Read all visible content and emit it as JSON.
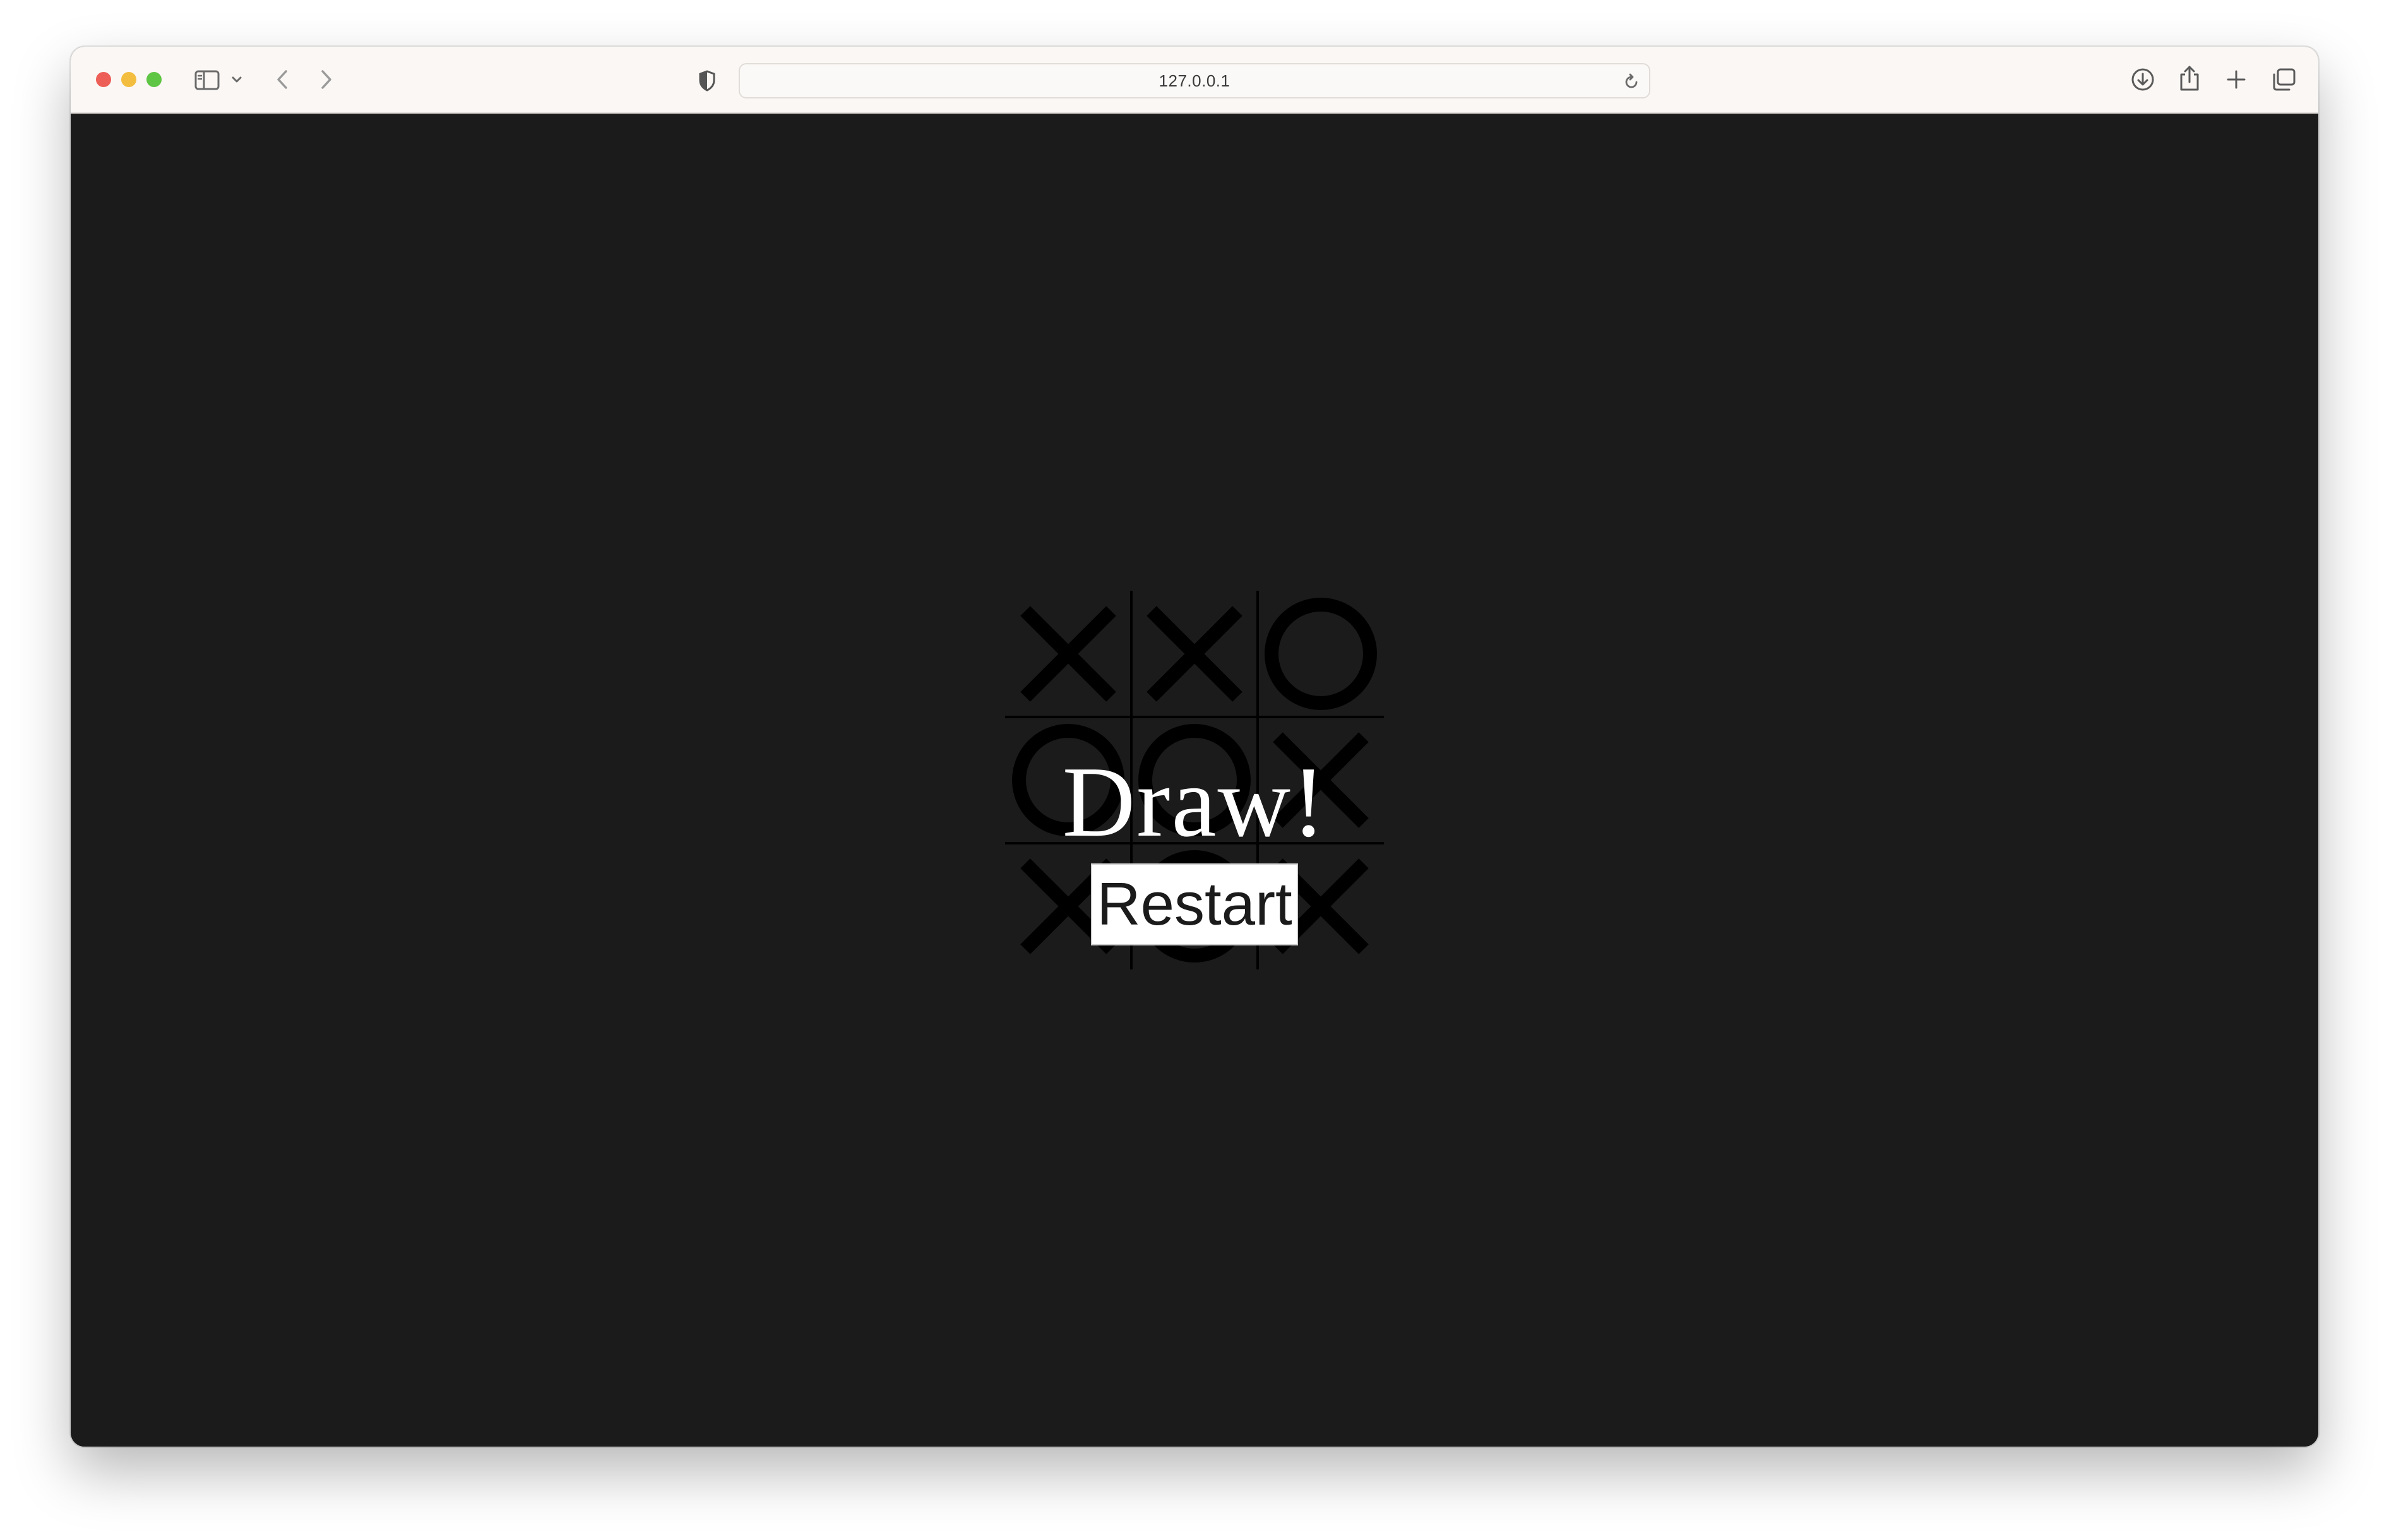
{
  "browser": {
    "address": "127.0.0.1",
    "icons": {
      "sidebar": "sidebar-icon",
      "chevron": "chevron-down-icon",
      "back": "back-arrow-icon",
      "forward": "forward-arrow-icon",
      "shield": "privacy-shield-icon",
      "reload": "reload-icon",
      "download": "download-icon",
      "share": "share-icon",
      "new_tab": "plus-icon",
      "tabs": "tabs-overview-icon"
    }
  },
  "game": {
    "result_text": "Draw!",
    "restart_label": "Restart",
    "board": [
      [
        "X",
        "X",
        "O"
      ],
      [
        "O",
        "O",
        "X"
      ],
      [
        "X",
        "O",
        "X"
      ]
    ]
  },
  "colors": {
    "page_background": "#1b1b1b",
    "mark_color": "#000000",
    "overlay_text": "#ffffff",
    "button_background": "#ffffff"
  }
}
